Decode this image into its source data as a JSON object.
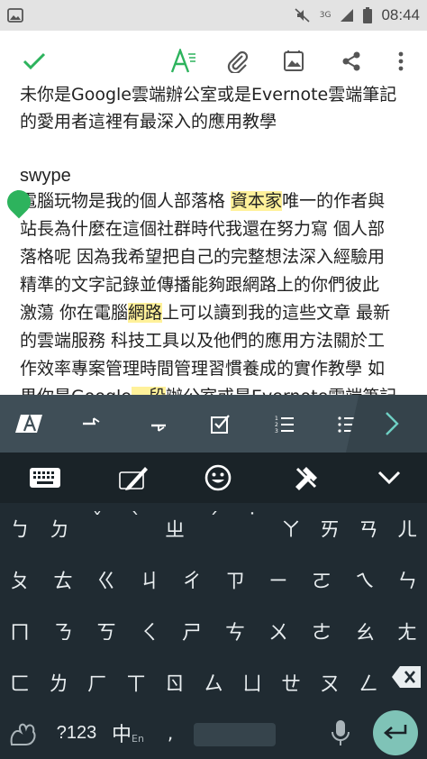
{
  "status_bar": {
    "time": "08:44",
    "network": "3G"
  },
  "note": {
    "paragraphs": [
      "未你是Google雲端辦公室或是Evernote雲端筆記",
      "的愛用者這裡有最深入的應用教學",
      "",
      "swype",
      "電腦玩物是我的個人部落格 資本家唯一的作者與",
      "站長為什麼在這個社群時代我還在努力寫 個人部",
      "落格呢 因為我希望把自己的完整想法深入經驗用",
      "精準的文字記錄並傳播能夠跟網路上的你們彼此",
      "激蕩 你在電腦網路上可以讀到我的這些文章 最新",
      "的雲端服務 科技工具以及他們的應用方法關於工",
      "作效率專案管理時間管理習慣養成的實作教學 如",
      "果你是Google一段辦公室或是Evernote雲端筆記"
    ],
    "highlights": [
      "資本家",
      "網路",
      "一段"
    ]
  },
  "keyboard": {
    "row1": [
      "ㄅ",
      "ㄉ",
      "ˇ",
      "ˋ",
      "ㄓ",
      "ˊ",
      "˙",
      "ㄚ",
      "ㄞ",
      "ㄢ",
      "ㄦ"
    ],
    "row2": [
      "ㄆ",
      "ㄊ",
      "ㄍ",
      "ㄐ",
      "ㄔ",
      "ㄗ",
      "ㄧ",
      "ㄛ",
      "ㄟ",
      "ㄣ"
    ],
    "row3": [
      "ㄇ",
      "ㄋ",
      "ㄎ",
      "ㄑ",
      "ㄕ",
      "ㄘ",
      "ㄨ",
      "ㄜ",
      "ㄠ",
      "ㄤ"
    ],
    "row4": [
      "ㄈ",
      "ㄌ",
      "ㄏ",
      "ㄒ",
      "ㄖ",
      "ㄙ",
      "ㄩ",
      "ㄝ",
      "ㄡ",
      "ㄥ"
    ],
    "symbols_label": "?123",
    "lang_label": "中",
    "lang_sub": "En"
  },
  "colors": {
    "accent": "#2db35d",
    "format_bar": "#3f4e57",
    "keyboard_bg": "#202b32",
    "highlight": "#fff19a",
    "enter": "#7fc3b7"
  }
}
